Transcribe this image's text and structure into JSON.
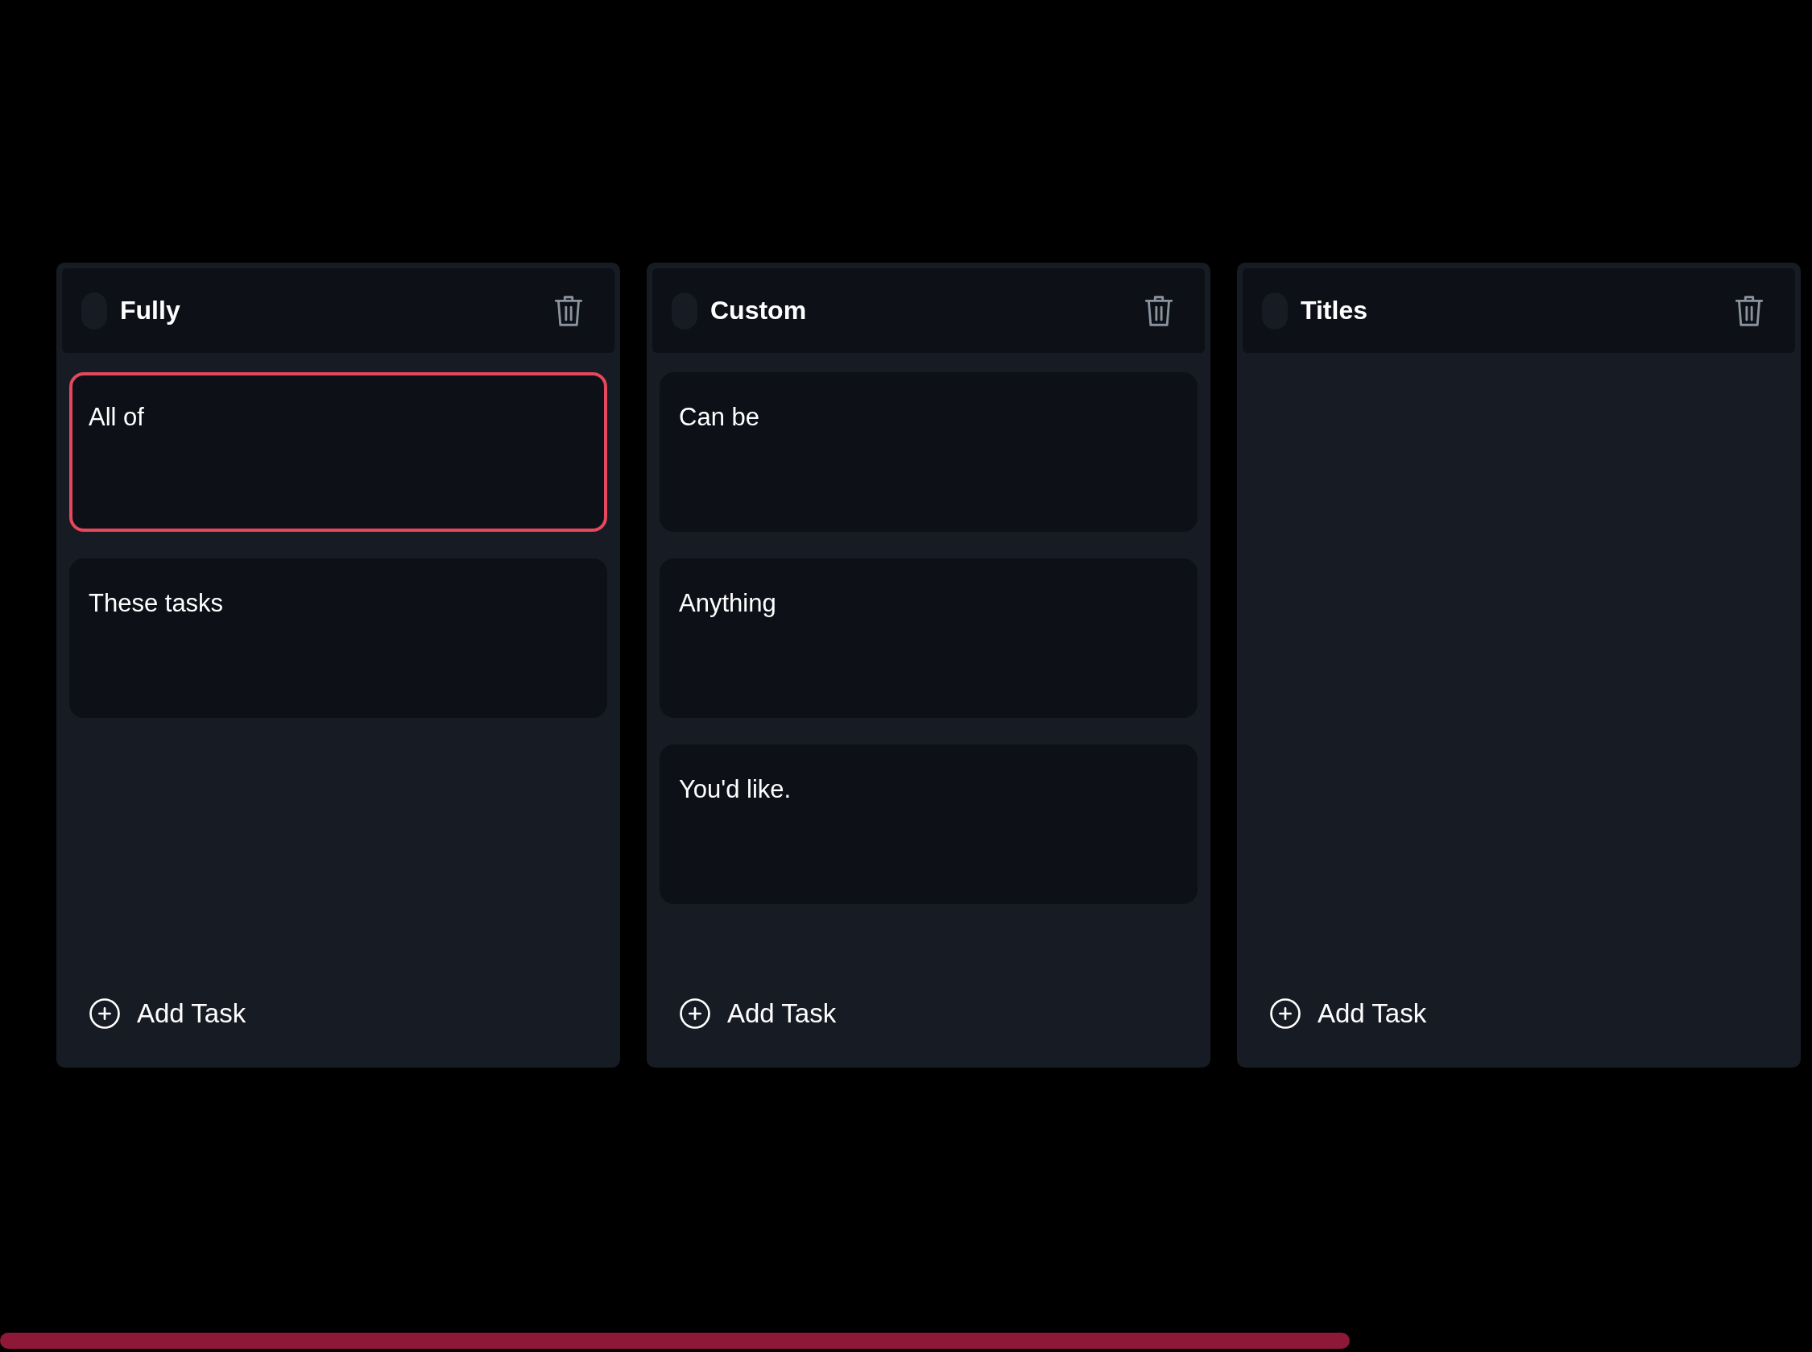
{
  "columns": [
    {
      "title": "Fully",
      "tasks": [
        {
          "text": "All of",
          "selected": true
        },
        {
          "text": "These tasks",
          "selected": false
        }
      ],
      "add_label": "Add Task"
    },
    {
      "title": "Custom",
      "tasks": [
        {
          "text": "Can be",
          "selected": false
        },
        {
          "text": "Anything",
          "selected": false
        },
        {
          "text": "You'd like.",
          "selected": false
        }
      ],
      "add_label": "Add Task"
    },
    {
      "title": "Titles",
      "add_label": "Add Task"
    }
  ]
}
